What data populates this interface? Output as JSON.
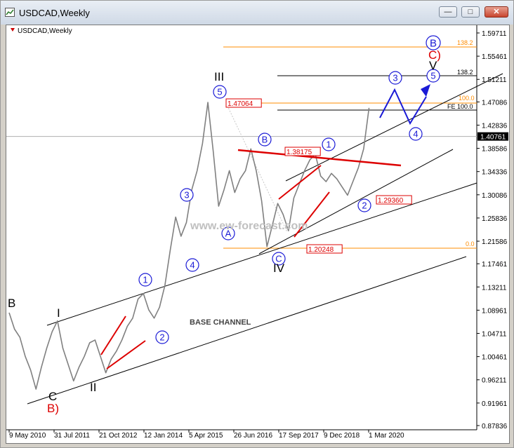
{
  "window": {
    "title": "USDCAD,Weekly",
    "buttons": {
      "minimize": "—",
      "maximize": "□",
      "close": "✕"
    }
  },
  "chart_data": {
    "type": "line",
    "title": "USDCAD,Weekly",
    "watermark": "www.ew-forecast.com",
    "current_price": "1.40761",
    "x_ticks": [
      "9 May 2010",
      "31 Jul 2011",
      "21 Oct 2012",
      "12 Jan 2014",
      "5 Apr 2015",
      "26 Jun 2016",
      "17 Sep 2017",
      "9 Dec 2018",
      "1 Mar 2020"
    ],
    "y_ticks": [
      "1.59711",
      "1.55461",
      "1.51211",
      "1.47086",
      "1.42836",
      "1.38586",
      "1.34336",
      "1.30086",
      "1.25836",
      "1.21586",
      "1.17461",
      "1.13211",
      "1.08961",
      "1.04711",
      "1.00461",
      "0.96211",
      "0.91961",
      "0.87836"
    ],
    "y_range": [
      0.87836,
      1.59711
    ],
    "series": [
      {
        "values": [
          [
            0,
            1.085
          ],
          [
            1,
            1.055
          ],
          [
            2,
            1.04
          ],
          [
            3,
            1.005
          ],
          [
            4,
            0.98
          ],
          [
            5,
            0.945
          ],
          [
            6,
            0.985
          ],
          [
            7,
            1.02
          ],
          [
            8,
            1.05
          ],
          [
            9,
            1.07
          ],
          [
            10,
            1.02
          ],
          [
            11,
            0.99
          ],
          [
            12,
            0.96
          ],
          [
            13,
            0.985
          ],
          [
            14,
            1.005
          ],
          [
            15,
            1.03
          ],
          [
            16,
            1.035
          ],
          [
            17,
            1.005
          ],
          [
            18,
            0.975
          ],
          [
            19,
            1.0
          ],
          [
            20,
            1.015
          ],
          [
            21,
            1.035
          ],
          [
            22,
            1.06
          ],
          [
            23,
            1.075
          ],
          [
            24,
            1.11
          ],
          [
            25,
            1.12
          ],
          [
            26,
            1.09
          ],
          [
            27,
            1.075
          ],
          [
            28,
            1.095
          ],
          [
            29,
            1.135
          ],
          [
            30,
            1.2
          ],
          [
            31,
            1.26
          ],
          [
            32,
            1.225
          ],
          [
            33,
            1.25
          ],
          [
            34,
            1.31
          ],
          [
            35,
            1.345
          ],
          [
            36,
            1.395
          ],
          [
            37,
            1.47
          ],
          [
            38,
            1.38
          ],
          [
            39,
            1.28
          ],
          [
            40,
            1.31
          ],
          [
            41,
            1.345
          ],
          [
            42,
            1.305
          ],
          [
            43,
            1.33
          ],
          [
            44,
            1.345
          ],
          [
            45,
            1.385
          ],
          [
            46,
            1.345
          ],
          [
            47,
            1.29
          ],
          [
            48,
            1.206
          ],
          [
            49,
            1.245
          ],
          [
            50,
            1.285
          ],
          [
            51,
            1.265
          ],
          [
            52,
            1.235
          ],
          [
            53,
            1.295
          ],
          [
            54,
            1.32
          ],
          [
            55,
            1.345
          ],
          [
            56,
            1.365
          ],
          [
            57,
            1.375
          ],
          [
            58,
            1.335
          ],
          [
            59,
            1.325
          ],
          [
            60,
            1.34
          ],
          [
            61,
            1.33
          ],
          [
            62,
            1.315
          ],
          [
            63,
            1.3
          ],
          [
            64,
            1.325
          ],
          [
            65,
            1.35
          ],
          [
            66,
            1.385
          ],
          [
            67,
            1.46
          ]
        ]
      }
    ],
    "price_labels": [
      "1.47064",
      "1.38175",
      "1.29360",
      "1.20248"
    ],
    "fib_labels": [
      "138.2",
      "138.2",
      "100.0",
      "FE 100.0",
      "0.0"
    ],
    "annotations": {
      "wave_roman": [
        "I",
        "II",
        "III",
        "IV",
        "V"
      ],
      "wave_circled": [
        "1",
        "2",
        "3",
        "4",
        "5",
        "1",
        "2",
        "3",
        "4",
        "5"
      ],
      "wave_abc": [
        "A",
        "B",
        "C",
        "B"
      ],
      "corrective": [
        "B",
        "C",
        "B)",
        "C)"
      ],
      "channel_label": "BASE CHANNEL"
    }
  },
  "colors": {
    "price": "#808080",
    "channel": "#000000",
    "fib": "#ff8c00",
    "accent_red": "#dd0000",
    "wave_blue": "#1a1ad6",
    "label_border": "#dd0000"
  }
}
